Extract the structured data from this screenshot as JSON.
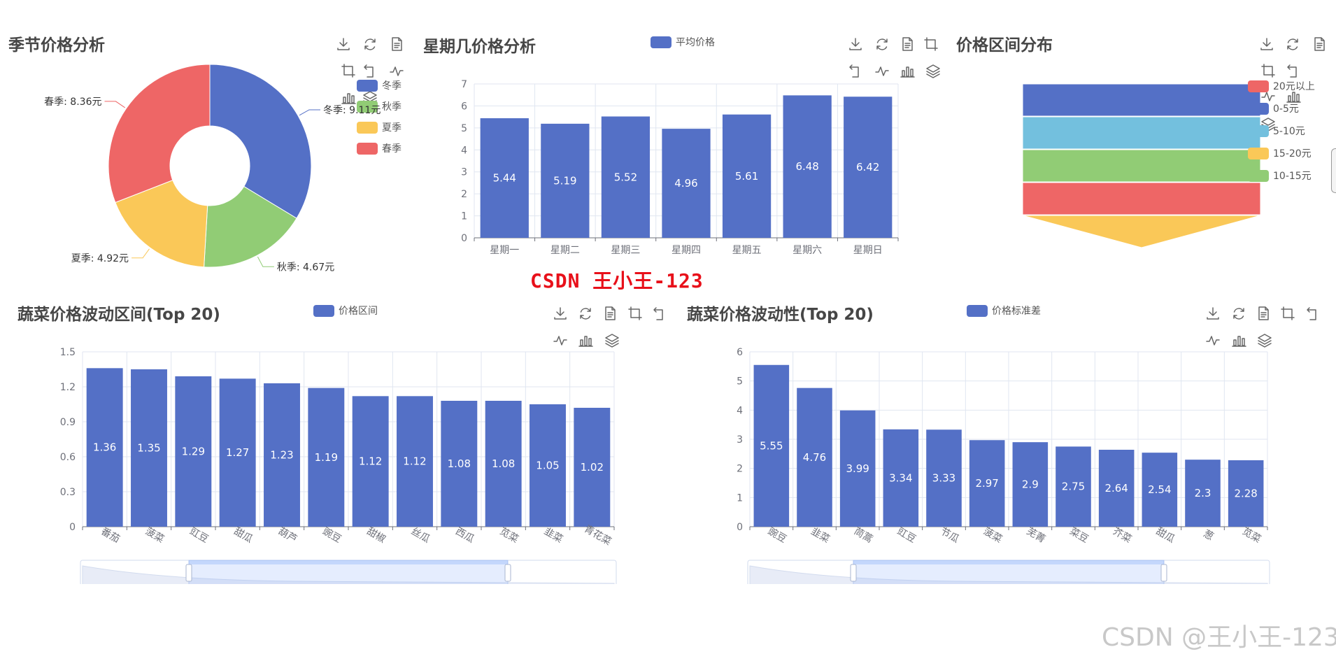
{
  "colors": {
    "blue": "#5470c6",
    "green": "#91cc75",
    "yellow": "#fac858",
    "red": "#ee6666",
    "lightblue": "#73c0de",
    "title": "#464646",
    "watermark_red": "#e8101a"
  },
  "toolbox_icons": [
    "download-icon",
    "refresh-icon",
    "data-view-icon",
    "zoom-icon",
    "zoom-reset-icon",
    "line-switch-icon",
    "bar-switch-icon",
    "stack-icon"
  ],
  "watermarks": {
    "center": "CSDN  王小王-123",
    "corner": "CSDN @王小王-123"
  },
  "chart_data": [
    {
      "id": "season",
      "type": "pie",
      "title": "季节价格分析",
      "donut": true,
      "legend": [
        "冬季",
        "秋季",
        "夏季",
        "春季"
      ],
      "legend_placement": "top-right",
      "slices": [
        {
          "name": "冬季",
          "value": 9.11,
          "label": "冬季: 9.11元",
          "color": "#5470c6"
        },
        {
          "name": "秋季",
          "value": 4.67,
          "label": "秋季: 4.67元",
          "color": "#91cc75"
        },
        {
          "name": "夏季",
          "value": 4.92,
          "label": "夏季: 4.92元",
          "color": "#fac858"
        },
        {
          "name": "春季",
          "value": 8.36,
          "label": "春季: 8.36元",
          "color": "#ee6666"
        }
      ]
    },
    {
      "id": "weekday",
      "type": "bar",
      "title": "星期几价格分析",
      "legend": [
        "平均价格"
      ],
      "legend_placement": "top-center",
      "categories": [
        "星期一",
        "星期二",
        "星期三",
        "星期四",
        "星期五",
        "星期六",
        "星期日"
      ],
      "series": [
        {
          "name": "平均价格",
          "values": [
            5.44,
            5.19,
            5.52,
            4.96,
            5.61,
            6.48,
            6.42
          ]
        }
      ],
      "ylim": [
        0,
        7
      ],
      "yticks": [
        0,
        1,
        2,
        3,
        4,
        5,
        6,
        7
      ],
      "grid": true
    },
    {
      "id": "range",
      "type": "funnel",
      "title": "价格区间分布",
      "legend": [
        {
          "name": "20元以上",
          "color": "#ee6666"
        },
        {
          "name": "0-5元",
          "color": "#5470c6"
        },
        {
          "name": "5-10元",
          "color": "#73c0de"
        },
        {
          "name": "15-20元",
          "color": "#fac858"
        },
        {
          "name": "10-15元",
          "color": "#91cc75"
        }
      ],
      "legend_placement": "right",
      "stages_top_to_bottom": [
        {
          "name": "0-5元",
          "color": "#5470c6"
        },
        {
          "name": "5-10元",
          "color": "#73c0de"
        },
        {
          "name": "10-15元",
          "color": "#91cc75"
        },
        {
          "name": "20元以上",
          "color": "#ee6666"
        },
        {
          "name": "15-20元",
          "color": "#fac858"
        }
      ]
    },
    {
      "id": "fluct_range",
      "type": "bar",
      "title": "蔬菜价格波动区间(Top 20)",
      "legend": [
        "价格区间"
      ],
      "legend_placement": "top-center",
      "categories": [
        "番茄",
        "菠菜",
        "豇豆",
        "甜瓜",
        "葫芦",
        "豌豆",
        "甜椒",
        "丝瓜",
        "西瓜",
        "苋菜",
        "韭菜",
        "青花菜"
      ],
      "series": [
        {
          "name": "价格区间",
          "values": [
            1.36,
            1.35,
            1.29,
            1.27,
            1.23,
            1.19,
            1.12,
            1.12,
            1.08,
            1.08,
            1.05,
            1.02
          ]
        }
      ],
      "ylim": [
        0,
        1.5
      ],
      "yticks": [
        "0",
        "0.3",
        "0.6",
        "0.9",
        "1.2",
        "1.5"
      ],
      "grid": true,
      "datazoom": {
        "start": 0.2,
        "end": 0.8
      }
    },
    {
      "id": "volatility",
      "type": "bar",
      "title": "蔬菜价格波动性(Top 20)",
      "legend": [
        "价格标准差"
      ],
      "legend_placement": "top-center",
      "categories": [
        "豌豆",
        "韭菜",
        "茼蒿",
        "豇豆",
        "节瓜",
        "菠菜",
        "芜菁",
        "菜豆",
        "芥菜",
        "甜瓜",
        "葱",
        "苋菜"
      ],
      "series": [
        {
          "name": "价格标准差",
          "values": [
            5.55,
            4.76,
            3.99,
            3.34,
            3.33,
            2.97,
            2.9,
            2.75,
            2.64,
            2.54,
            2.3,
            2.28
          ]
        }
      ],
      "ylim": [
        0,
        6
      ],
      "yticks": [
        "0",
        "1",
        "2",
        "3",
        "4",
        "5",
        "6"
      ],
      "grid": true,
      "datazoom": {
        "start": 0.2,
        "end": 0.8
      }
    }
  ]
}
